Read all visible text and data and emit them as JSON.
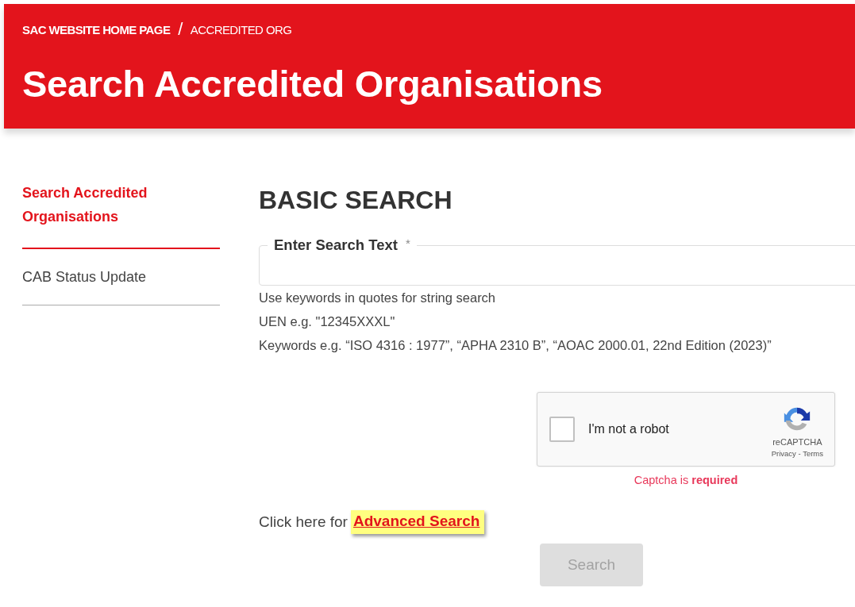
{
  "breadcrumb": [
    {
      "label": "SAC WEBSITE HOME PAGE",
      "kind": "link"
    },
    {
      "label": "/",
      "kind": "separator"
    },
    {
      "label": "ACCREDITED ORG",
      "kind": "current"
    }
  ],
  "title": "Search Accredited Organisations",
  "sidebar": {
    "items": [
      {
        "label": "Search Accredited Organisations",
        "selected": true
      },
      {
        "label": "CAB Status Update",
        "selected": false
      }
    ]
  },
  "heading": "BASIC SEARCH",
  "search_field": {
    "label": "Enter Search Text",
    "required_mark": "*"
  },
  "hints": [
    "Use keywords in quotes for string search",
    "UEN e.g. \"12345XXXL\"",
    "Keywords e.g. “ISO 4316 : 1977”, “APHA 2310 B”, “AOAC 2000.01, 22nd Edition (2023)”"
  ],
  "captcha": {
    "checked": false,
    "label": "I'm not a robot",
    "brand": "reCAPTCHA",
    "links": "Privacy - Terms",
    "error": "Captcha is **required**"
  },
  "advanced": {
    "prompt": "Click here for",
    "link": "Advanced Search"
  },
  "search_button": {
    "label": "Search",
    "disabled": true
  }
}
